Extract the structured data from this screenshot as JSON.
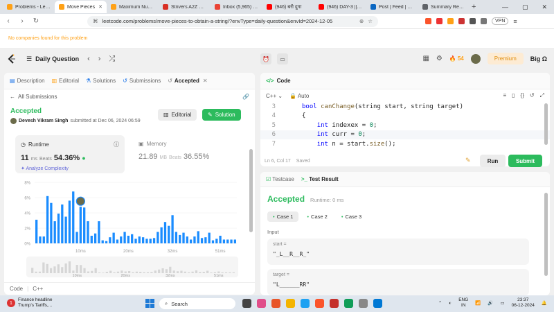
{
  "browser": {
    "tabs": [
      {
        "title": "Problems - LeetC",
        "color": "#ffa116",
        "active": false
      },
      {
        "title": "Move Pieces",
        "color": "#ffa116",
        "active": true
      },
      {
        "title": "Maximum Numbe",
        "color": "#ffa116",
        "active": false
      },
      {
        "title": "Strivers A2Z DSA",
        "color": "#d93025",
        "active": false
      },
      {
        "title": "Inbox (5,965) - de",
        "color": "#ea4335",
        "active": false
      },
      {
        "title": "(946) बरी दुगा",
        "color": "#ff0000",
        "active": false
      },
      {
        "title": "(946) DAY-3 || PE",
        "color": "#ff0000",
        "active": false
      },
      {
        "title": "Post | Feed | Linke",
        "color": "#0a66c2",
        "active": false
      },
      {
        "title": "Summary Report",
        "color": "#5f6368",
        "active": false
      }
    ],
    "new_tab": "+",
    "window_controls": [
      "—",
      "▢",
      "✕"
    ],
    "url": "leetcode.com/problems/move-pieces-to-obtain-a-string/?envType=daily-question&envId=2024-12-05",
    "vpn": "VPN"
  },
  "notice": "No companies found for this problem",
  "nav": {
    "daily_question": "Daily Question",
    "streak": "54",
    "premium": "Premium",
    "user": "Big Ω"
  },
  "left": {
    "tabs": [
      "Description",
      "Editorial",
      "Solutions",
      "Submissions",
      "Accepted"
    ],
    "all_submissions": "All Submissions",
    "status": "Accepted",
    "user": "Devesh Vikram Singh",
    "submitted": "submitted at Dec 06, 2024 06:59",
    "editorial_btn": "Editorial",
    "solution_btn": "Solution",
    "runtime": {
      "label": "Runtime",
      "value": "11",
      "unit": "ms",
      "beats_label": "Beats",
      "beats": "54.36%"
    },
    "analyze": "Analyze Complexity",
    "memory": {
      "label": "Memory",
      "value": "21.89",
      "unit": "MB",
      "beats_label": "Beats",
      "beats": "36.55%"
    },
    "bottom_tabs": [
      "Code",
      "C++"
    ]
  },
  "chart_data": {
    "type": "bar",
    "y_ticks": [
      "8%",
      "6%",
      "4%",
      "2%",
      "0%"
    ],
    "ylim": [
      0,
      8
    ],
    "x_ticks": [
      "10ms",
      "20ms",
      "32ms",
      "51ms"
    ],
    "x_tick_index": [
      12,
      25,
      37,
      50
    ],
    "highlight_index": 12,
    "values": [
      3.1,
      0.9,
      0.9,
      6.2,
      5.3,
      2.9,
      3.9,
      5.1,
      3.5,
      5.6,
      6.8,
      1.5,
      4.8,
      4.7,
      2.9,
      1.0,
      1.3,
      2.9,
      0.4,
      0.3,
      0.8,
      1.4,
      0.5,
      0.9,
      1.5,
      1.0,
      1.2,
      0.6,
      0.9,
      0.8,
      0.6,
      0.6,
      0.7,
      1.5,
      2.1,
      2.8,
      2.3,
      3.7,
      1.5,
      1.1,
      1.4,
      0.9,
      0.5,
      0.9,
      1.6,
      0.7,
      0.8,
      1.4,
      0.4,
      0.6,
      1.0,
      0.5,
      0.5,
      0.5,
      0.5
    ]
  },
  "code": {
    "title": "Code",
    "language": "C++",
    "autosave": "Auto",
    "lines": [
      {
        "no": "3",
        "html": "<span class=\"kw\">bool</span> <span class=\"fn\">canChange</span>(string start, string target)"
      },
      {
        "no": "4",
        "html": "{"
      },
      {
        "no": "5",
        "html": "    <span class=\"kw\">int</span> indexex = <span class=\"num\">0</span>;"
      },
      {
        "no": "6",
        "html": "    <span class=\"kw\">int</span> curr = <span class=\"num\">0</span>;"
      },
      {
        "no": "7",
        "html": "    <span class=\"kw\">int</span> n = start.<span class=\"fn\">size</span>();"
      }
    ],
    "cursor": "Ln 6, Col 17",
    "saved": "Saved",
    "run": "Run",
    "submit": "Submit"
  },
  "result": {
    "tabs": [
      "Testcase",
      "Test Result"
    ],
    "status": "Accepted",
    "runtime": "Runtime: 0 ms",
    "cases": [
      "Case 1",
      "Case 2",
      "Case 3"
    ],
    "input_label": "Input",
    "start_label": "start =",
    "start_value": "\"_L__R__R_\"",
    "target_label": "target =",
    "target_value": "\"L______RR\""
  },
  "taskbar": {
    "news_count": "1",
    "news_title": "Finance headline",
    "news_sub": "Trump's Tariffs,...",
    "search": "Search",
    "lang_1": "ENG",
    "lang_2": "IN",
    "time": "23:37",
    "date": "06-12-2024"
  }
}
